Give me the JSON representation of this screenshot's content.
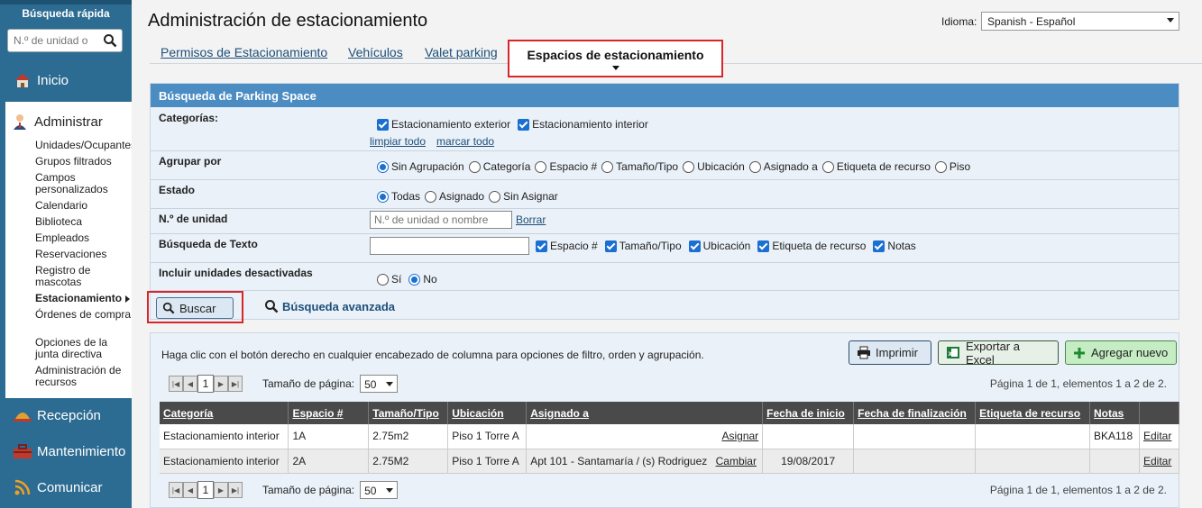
{
  "sidebar": {
    "quick_search_title": "Búsqueda rápida",
    "quick_search_placeholder": "N.º de unidad o",
    "nav": [
      {
        "label": "Inicio",
        "icon": "house-icon"
      },
      {
        "label": "Administrar",
        "icon": "person-icon"
      },
      {
        "label": "Recepción",
        "icon": "concierge-bell-icon"
      },
      {
        "label": "Mantenimiento",
        "icon": "toolbox-icon"
      },
      {
        "label": "Comunicar",
        "icon": "wifi-icon"
      }
    ],
    "admin_items": [
      "Unidades/Ocupantes",
      "Grupos filtrados",
      "Campos personalizados",
      "Calendario",
      "Biblioteca",
      "Empleados",
      "Reservaciones",
      "Registro de mascotas",
      "Estacionamiento",
      "Órdenes de compra",
      "Opciones de la junta directiva",
      "Administración de recursos"
    ]
  },
  "header": {
    "title": "Administración de estacionamiento",
    "language_label": "Idioma:",
    "language_value": "Spanish - Español"
  },
  "tabs": [
    "Permisos de Estacionamiento",
    "Vehículos",
    "Valet parking",
    "Espacios de estacionamiento"
  ],
  "search": {
    "panel_title": "Búsqueda de Parking Space",
    "categories_label": "Categorías:",
    "categories": [
      "Estacionamiento exterior",
      "Estacionamiento interior"
    ],
    "clear_all": "limpiar todo",
    "mark_all": "marcar todo",
    "group_label": "Agrupar por",
    "group_options": [
      "Sin Agrupación",
      "Categoría",
      "Espacio #",
      "Tamaño/Tipo",
      "Ubicación",
      "Asignado a",
      "Etiqueta de recurso",
      "Piso"
    ],
    "state_label": "Estado",
    "state_options": [
      "Todas",
      "Asignado",
      "Sin Asignar"
    ],
    "unit_label": "N.º de unidad",
    "unit_placeholder": "N.º de unidad o nombre",
    "unit_clear": "Borrar",
    "text_label": "Búsqueda de Texto",
    "text_fields": [
      "Espacio #",
      "Tamaño/Tipo",
      "Ubicación",
      "Etiqueta de recurso",
      "Notas"
    ],
    "inactive_label": "Incluir unidades desactivadas",
    "inactive_options": [
      "Sí",
      "No"
    ],
    "search_button": "Buscar",
    "advanced_search": "Búsqueda avanzada"
  },
  "results": {
    "hint": "Haga clic con el botón derecho en cualquier encabezado de columna para opciones de filtro, orden y agrupación.",
    "print": "Imprimir",
    "export": "Exportar a Excel",
    "add_new": "Agregar nuevo",
    "page_size_label": "Tamaño de página:",
    "page_size": "50",
    "current_page": "1",
    "page_info": "Página 1 de 1, elementos 1 a 2 de 2.",
    "columns": [
      "Categoría",
      "Espacio #",
      "Tamaño/Tipo",
      "Ubicación",
      "Asignado a",
      "Fecha de inicio",
      "Fecha de finalización",
      "Etiqueta de recurso",
      "Notas",
      ""
    ],
    "rows": [
      {
        "categoria": "Estacionamiento interior",
        "espacio": "1A",
        "tamano": "2.75m2",
        "ubicacion": "Piso 1 Torre A",
        "asignado": "",
        "accion": "Asignar",
        "inicio": "",
        "fin": "",
        "etiqueta": "",
        "notas": "BKA118",
        "editar": "Editar"
      },
      {
        "categoria": "Estacionamiento interior",
        "espacio": "2A",
        "tamano": "2.75M2",
        "ubicacion": "Piso 1 Torre A",
        "asignado": "Apt 101 - Santamaría / (s) Rodriguez",
        "accion": "Cambiar",
        "inicio": "19/08/2017",
        "fin": "",
        "etiqueta": "",
        "notas": "",
        "editar": "Editar"
      }
    ]
  }
}
